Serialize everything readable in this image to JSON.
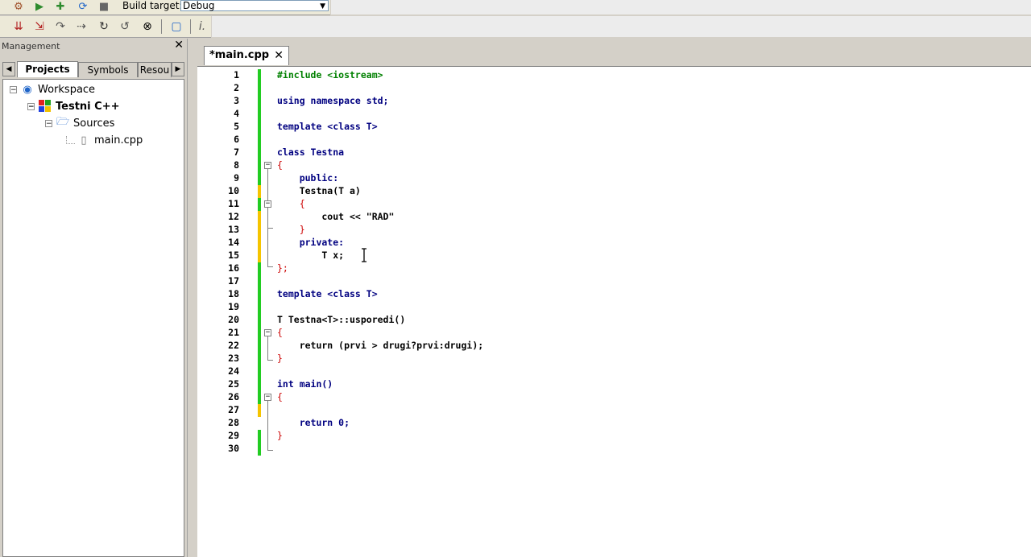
{
  "toolbar": {
    "build_target_label": "Build target:",
    "build_target_value": "Debug"
  },
  "management": {
    "title": "Management",
    "tabs": [
      "Projects",
      "Symbols",
      "Resou"
    ],
    "tree": {
      "workspace": "Workspace",
      "project": "Testni C++",
      "folder": "Sources",
      "file": "main.cpp"
    }
  },
  "editor": {
    "tab_label": "*main.cpp",
    "line_numbers": [
      "1",
      "2",
      "3",
      "4",
      "5",
      "6",
      "7",
      "8",
      "9",
      "10",
      "11",
      "12",
      "13",
      "14",
      "15",
      "16",
      "17",
      "18",
      "19",
      "20",
      "21",
      "22",
      "23",
      "24",
      "25",
      "26",
      "27",
      "28",
      "29",
      "30"
    ],
    "lines": [
      "#include <iostream>",
      "",
      "using namespace std;",
      "",
      "template <class T>",
      "",
      "class Testna",
      "{",
      "    public:",
      "    Testna(T a)",
      "    {",
      "        cout << \"RAD\"",
      "    }",
      "    private:",
      "        T x;",
      "};",
      "",
      "template <class T>",
      "",
      "T Testna<T>::usporedi()",
      "{",
      "    return (prvi > drugi?prvi:drugi);",
      "}",
      "",
      "int main()",
      "{",
      "",
      "    return 0;",
      "}",
      ""
    ]
  },
  "colors": {
    "changed_saved": "#22cc22",
    "changed_unsaved": "#f5c400",
    "keyword": "#000080",
    "string": "#0000ff",
    "operator": "#cc0000"
  }
}
